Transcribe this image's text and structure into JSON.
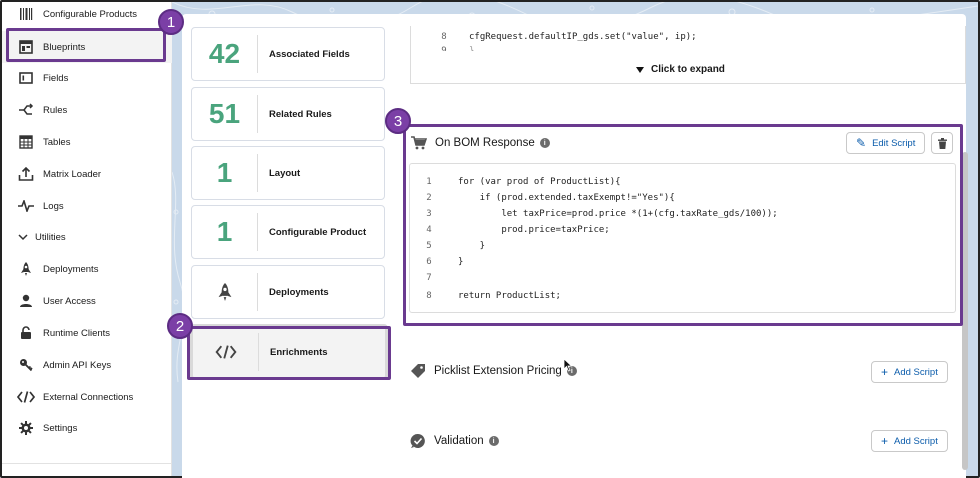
{
  "sidebar": {
    "items": [
      {
        "label": "Configurable Products",
        "icon": "barcode-icon"
      },
      {
        "label": "Blueprints",
        "icon": "blueprint-icon"
      },
      {
        "label": "Fields",
        "icon": "fields-icon"
      },
      {
        "label": "Rules",
        "icon": "rules-icon"
      },
      {
        "label": "Tables",
        "icon": "table-icon"
      },
      {
        "label": "Matrix Loader",
        "icon": "upload-icon"
      },
      {
        "label": "Logs",
        "icon": "pulse-icon"
      },
      {
        "label": "Utilities",
        "icon": "chevron-down-icon"
      },
      {
        "label": "Deployments",
        "icon": "rocket-icon"
      },
      {
        "label": "User Access",
        "icon": "user-icon"
      },
      {
        "label": "Runtime Clients",
        "icon": "lock-icon"
      },
      {
        "label": "Admin API Keys",
        "icon": "key-icon"
      },
      {
        "label": "External Connections",
        "icon": "code-icon"
      },
      {
        "label": "Settings",
        "icon": "gear-icon"
      }
    ]
  },
  "cards": [
    {
      "value": "42",
      "label": "Associated Fields"
    },
    {
      "value": "51",
      "label": "Related Rules"
    },
    {
      "value": "1",
      "label": "Layout"
    },
    {
      "value": "1",
      "label": "Configurable Product"
    },
    {
      "value": "",
      "label": "Deployments",
      "icon": "rocket-icon"
    },
    {
      "value": "",
      "label": "Enrichments",
      "icon": "code-icon"
    }
  ],
  "top_code": {
    "line_no": "8",
    "code": "cfgRequest.defaultIP_gds.set(\"value\", ip);",
    "line_no_2": "9",
    "code_2": "}",
    "expand_label": "Click to expand"
  },
  "bom": {
    "title": "On BOM Response",
    "edit_label": "Edit Script",
    "lines": [
      {
        "n": "1",
        "code": "for (var prod of ProductList){"
      },
      {
        "n": "2",
        "code": "    if (prod.extended.taxExempt!=\"Yes\"){"
      },
      {
        "n": "3",
        "code": "        let taxPrice=prod.price *(1+(cfg.taxRate_gds/100));"
      },
      {
        "n": "4",
        "code": "        prod.price=taxPrice;"
      },
      {
        "n": "5",
        "code": "    }"
      },
      {
        "n": "6",
        "code": "}"
      },
      {
        "n": "7",
        "code": ""
      },
      {
        "n": "8",
        "code": "return ProductList;"
      }
    ]
  },
  "sections": [
    {
      "title": "Picklist Extension Pricing",
      "button": "Add Script"
    },
    {
      "title": "Validation",
      "button": "Add Script"
    }
  ],
  "badges": [
    "1",
    "2",
    "3"
  ],
  "colors": {
    "accent_purple": "#6a3a8f",
    "number_green": "#4aa47d",
    "link_blue": "#0b5cab"
  }
}
